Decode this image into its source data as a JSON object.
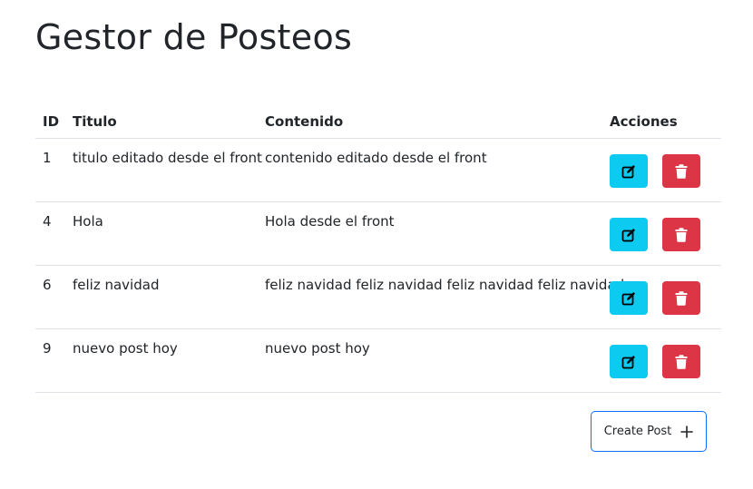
{
  "page": {
    "title": "Gestor de Posteos"
  },
  "table": {
    "headers": {
      "id": "ID",
      "titulo": "Titulo",
      "contenido": "Contenido",
      "acciones": "Acciones"
    },
    "rows": [
      {
        "id": "1",
        "titulo": "titulo editado desde el front",
        "contenido": "contenido editado desde el front"
      },
      {
        "id": "4",
        "titulo": "Hola",
        "contenido": "Hola desde el front"
      },
      {
        "id": "6",
        "titulo": "feliz navidad",
        "contenido": "feliz navidad feliz navidad feliz navidad feliz navidad"
      },
      {
        "id": "9",
        "titulo": "nuevo post hoy",
        "contenido": "nuevo post hoy"
      }
    ],
    "row_actions": [
      {
        "icon": "edit-icon",
        "color": "#0dcaf0"
      },
      {
        "icon": "trash-icon",
        "color": "#dc3545"
      }
    ]
  },
  "create_button": {
    "label": "Create Post",
    "icon": "plus-icon",
    "border_color": "#0d6efd"
  }
}
